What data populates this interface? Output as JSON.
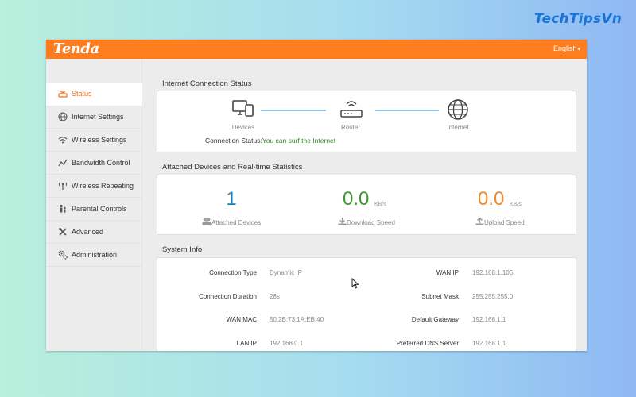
{
  "watermark": "TechTipsVn",
  "header": {
    "logo": "Tenda",
    "language": "English"
  },
  "sidebar": {
    "items": [
      {
        "label": "Status",
        "icon": "router-status-icon",
        "active": true
      },
      {
        "label": "Internet Settings",
        "icon": "globe-icon",
        "active": false
      },
      {
        "label": "Wireless Settings",
        "icon": "wifi-icon",
        "active": false
      },
      {
        "label": "Bandwidth Control",
        "icon": "bandwidth-chart-icon",
        "active": false
      },
      {
        "label": "Wireless Repeating",
        "icon": "repeater-icon",
        "active": false
      },
      {
        "label": "Parental Controls",
        "icon": "parental-icon",
        "active": false
      },
      {
        "label": "Advanced",
        "icon": "tools-icon",
        "active": false
      },
      {
        "label": "Administration",
        "icon": "gears-icon",
        "active": false
      }
    ]
  },
  "internet_status": {
    "title": "Internet Connection Status",
    "devices_label": "Devices",
    "router_label": "Router",
    "internet_label": "Internet",
    "status_prefix": "Connection Status:",
    "status_value": "You can surf the Internet"
  },
  "stats": {
    "title": "Attached Devices and Real-time Statistics",
    "attached_count": "1",
    "attached_label": "Attached Devices",
    "download_value": "0.0",
    "download_unit": "KB/s",
    "download_label": "Download Speed",
    "upload_value": "0.0",
    "upload_unit": "KB/s",
    "upload_label": "Upload Speed",
    "colors": {
      "attached": "#1a7fc1",
      "download": "#3a9a2f",
      "upload": "#f08a2a"
    }
  },
  "system_info": {
    "title": "System Info",
    "left": [
      {
        "label": "Connection Type",
        "value": "Dynamic IP"
      },
      {
        "label": "Connection Duration",
        "value": "28s"
      },
      {
        "label": "WAN MAC",
        "value": "50:2B:73:1A:EB:40"
      },
      {
        "label": "LAN IP",
        "value": "192.168.0.1"
      }
    ],
    "right": [
      {
        "label": "WAN IP",
        "value": "192.168.1.106"
      },
      {
        "label": "Subnet Mask",
        "value": "255.255.255.0"
      },
      {
        "label": "Default Gateway",
        "value": "192.168.1.1"
      },
      {
        "label": "Preferred DNS Server",
        "value": "192.168.1.1"
      }
    ]
  },
  "colors": {
    "accent": "#ff7d1f",
    "active_text": "#f06a10",
    "link_line": "#8fc2e5"
  }
}
